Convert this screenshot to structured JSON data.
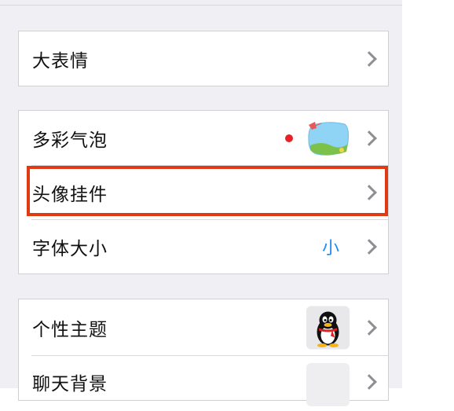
{
  "group1": {
    "items": [
      {
        "label": "大表情"
      }
    ]
  },
  "group2": {
    "items": [
      {
        "label": "多彩气泡",
        "badge": "red-dot",
        "thumbnail": "bubble-icon"
      },
      {
        "label": "头像挂件"
      },
      {
        "label": "字体大小",
        "value": "小"
      }
    ]
  },
  "group3": {
    "items": [
      {
        "label": "个性主题",
        "thumbnail": "penguin-icon"
      },
      {
        "label": "聊天背景",
        "thumbnail": "blank-thumbnail"
      }
    ]
  },
  "colors": {
    "accent": "#1a8cff",
    "highlight": "#e03a15",
    "badge": "#e8202a",
    "background": "#efeff4"
  }
}
